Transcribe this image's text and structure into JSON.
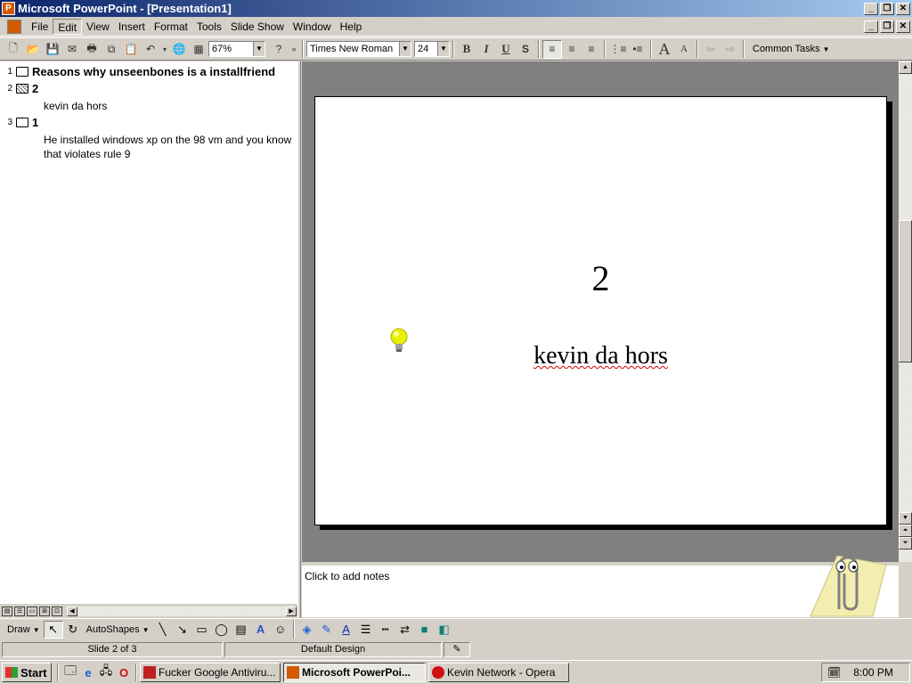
{
  "window": {
    "title": "Microsoft PowerPoint - [Presentation1]",
    "controls": [
      "_",
      "❐",
      "✕"
    ]
  },
  "menu": {
    "items": [
      "File",
      "Edit",
      "View",
      "Insert",
      "Format",
      "Tools",
      "Slide Show",
      "Window",
      "Help"
    ],
    "active_item": "Edit"
  },
  "toolbar": {
    "zoom": "67%",
    "font_name": "Times New Roman",
    "font_size": "24",
    "bold_label": "B",
    "italic_label": "I",
    "underline_label": "U",
    "shadow_label": "S",
    "increase_font_label": "A",
    "decrease_font_label": "A",
    "common_tasks": "Common Tasks"
  },
  "outline": {
    "slides": [
      {
        "number": "1",
        "title": "Reasons why unseenbones is a installfriend",
        "body": []
      },
      {
        "number": "2",
        "title": "2",
        "body": [
          "kevin da hors"
        ]
      },
      {
        "number": "3",
        "title": "1",
        "body": [
          "He installed windows xp on the 98 vm and you know that violates rule 9"
        ]
      }
    ]
  },
  "slide": {
    "title": "2",
    "body": "kevin da hors"
  },
  "notes": {
    "placeholder": "Click to add notes"
  },
  "drawing_toolbar": {
    "draw_label": "Draw",
    "autoshapes_label": "AutoShapes"
  },
  "status": {
    "slide_position": "Slide 2 of 3",
    "design": "Default Design"
  },
  "taskbar": {
    "start_label": "Start",
    "tasks": [
      {
        "label": "Fucker Google Antiviru...",
        "active": false
      },
      {
        "label": "Microsoft PowerPoi...",
        "active": true
      },
      {
        "label": "Kevin Network - Opera",
        "active": false
      }
    ],
    "clock": "8:00 PM"
  },
  "colors": {
    "titlebar_start": "#0a246a",
    "titlebar_end": "#a6caf0",
    "workspace": "#808080",
    "spelling_squiggle": "#d00000"
  }
}
